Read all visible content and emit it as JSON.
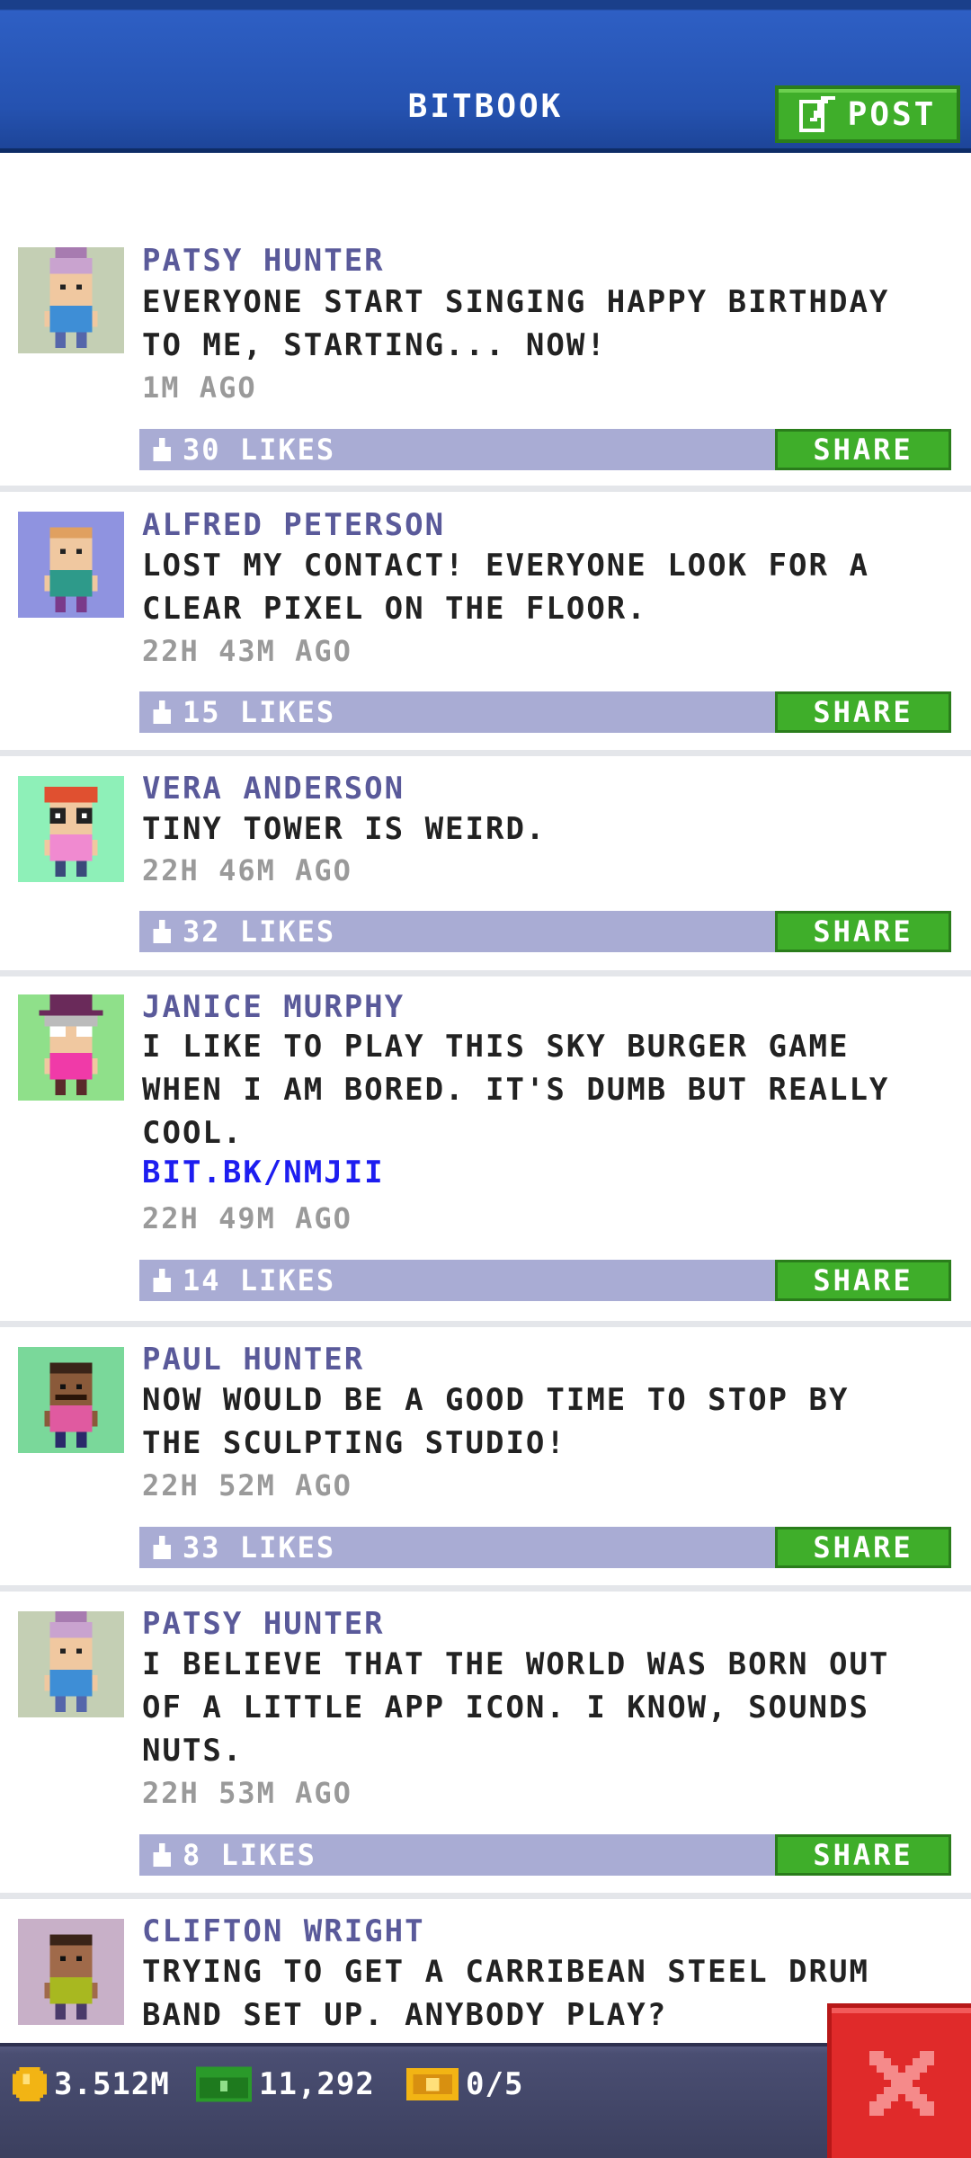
{
  "header": {
    "title": "BITBOOK",
    "post_label": "POST"
  },
  "colors": {
    "header_blue": "#2552b0",
    "green_button": "#3fae2a",
    "likes_bar": "#a9acd4",
    "name_color": "#5a5a9a",
    "link_color": "#1d1df0",
    "close_red": "#e02a2a"
  },
  "share_label": "SHARE",
  "posts": [
    {
      "name": "PATSY HUNTER",
      "line1": "EVERYONE START SINGING HAPPY BIRTHDAY",
      "line2": "TO ME, STARTING... NOW!",
      "line3": "",
      "link": "",
      "time": "1M AGO",
      "likes": "30 LIKES",
      "avatar": "patsy-avatar"
    },
    {
      "name": "ALFRED PETERSON",
      "line1": "LOST MY CONTACT! EVERYONE LOOK FOR A",
      "line2": "CLEAR PIXEL ON THE FLOOR.",
      "line3": "",
      "link": "",
      "time": "22H 43M AGO",
      "likes": "15 LIKES",
      "avatar": "alfred-avatar"
    },
    {
      "name": "VERA ANDERSON",
      "line1": "TINY TOWER IS WEIRD.",
      "line2": "",
      "line3": "",
      "link": "",
      "time": "22H 46M AGO",
      "likes": "32 LIKES",
      "avatar": "vera-avatar"
    },
    {
      "name": "JANICE MURPHY",
      "line1": "I LIKE TO PLAY THIS SKY BURGER GAME",
      "line2": "WHEN I AM BORED. IT'S DUMB BUT REALLY",
      "line3": "COOL.",
      "link": "BIT.BK/NMJII",
      "time": "22H 49M AGO",
      "likes": "14 LIKES",
      "avatar": "janice-avatar"
    },
    {
      "name": "PAUL HUNTER",
      "line1": "NOW WOULD BE A GOOD TIME TO STOP BY",
      "line2": "THE SCULPTING STUDIO!",
      "line3": "",
      "link": "",
      "time": "22H 52M AGO",
      "likes": "33 LIKES",
      "avatar": "paul-avatar"
    },
    {
      "name": "PATSY HUNTER",
      "line1": "I BELIEVE THAT THE WORLD WAS BORN OUT",
      "line2": "OF A LITTLE APP ICON. I KNOW, SOUNDS",
      "line3": "NUTS.",
      "link": "",
      "time": "22H 53M AGO",
      "likes": "8 LIKES",
      "avatar": "patsy-avatar"
    },
    {
      "name": "CLIFTON WRIGHT",
      "line1": "TRYING TO GET A CARRIBEAN STEEL DRUM",
      "line2": "BAND SET UP. ANYBODY PLAY?",
      "line3": "",
      "link": "",
      "time": "",
      "likes": "",
      "avatar": "clifton-avatar"
    }
  ],
  "bottom_bar": {
    "coins": "3.512M",
    "bux": "11,292",
    "tickets": "0/5"
  }
}
